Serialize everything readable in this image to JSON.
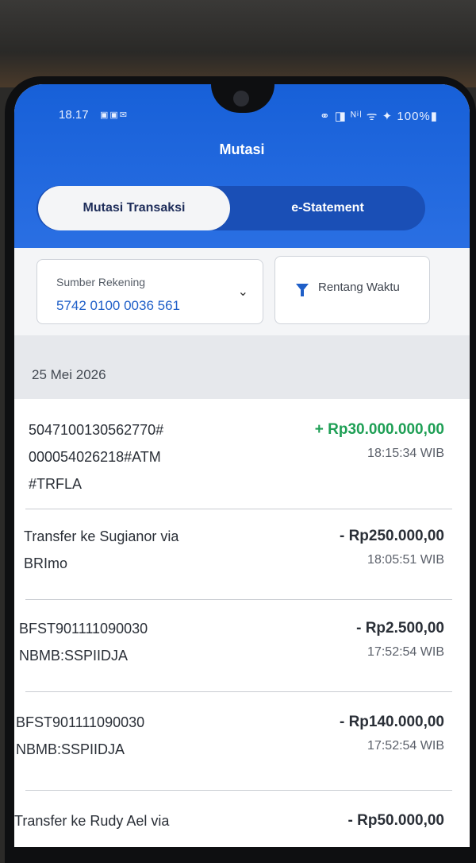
{
  "status_bar": {
    "time": "18.17",
    "icons": [
      "sim-icon",
      "mail-icon",
      "mail-icon"
    ],
    "right": "⚭ ◨ ᴺⁱˡ ᯤ ✦ 100%▮"
  },
  "app": {
    "title": "Mutasi",
    "tabs": [
      {
        "label": "Mutasi Transaksi",
        "active": true
      },
      {
        "label": "e-Statement",
        "active": false
      }
    ]
  },
  "filters": {
    "source_label": "Sumber Rekening",
    "source_value": "5742 0100 0036 561",
    "range_label": "Rentang Waktu"
  },
  "date_header": "25 Mei 2026",
  "transactions": [
    {
      "desc": "5047100130562770#\n000054026218#ATM\n#TRFLA",
      "amount": "+ Rp30.000.000,00",
      "time": "18:15:34 WIB",
      "type": "credit"
    },
    {
      "desc": "Transfer ke Sugianor via\nBRImo",
      "amount": "- Rp250.000,00",
      "time": "18:05:51 WIB",
      "type": "debit"
    },
    {
      "desc": "BFST901111090030\nNBMB:SSPIIDJA",
      "amount": "- Rp2.500,00",
      "time": "17:52:54 WIB",
      "type": "debit"
    },
    {
      "desc": "BFST901111090030\nNBMB:SSPIIDJA",
      "amount": "- Rp140.000,00",
      "time": "17:52:54 WIB",
      "type": "debit"
    },
    {
      "desc": "Transfer ke Rudy Ael via",
      "amount": "- Rp50.000,00",
      "time": "",
      "type": "debit"
    }
  ]
}
